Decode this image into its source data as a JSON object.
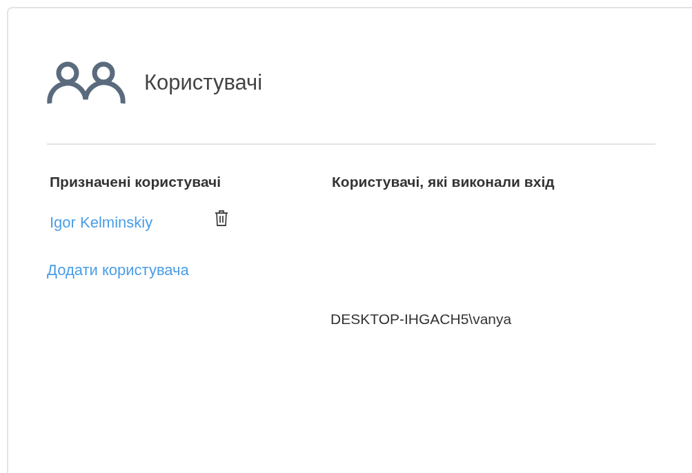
{
  "header": {
    "title": "Користувачі"
  },
  "assigned": {
    "heading": "Призначені користувачі",
    "users": [
      {
        "name": "Igor Kelminskiy"
      }
    ],
    "add_link": "Додати користувача"
  },
  "signed_in": {
    "heading": "Користувачі, які виконали вхід",
    "users": [
      "DESKTOP-IHGACH5\\vanya"
    ]
  }
}
